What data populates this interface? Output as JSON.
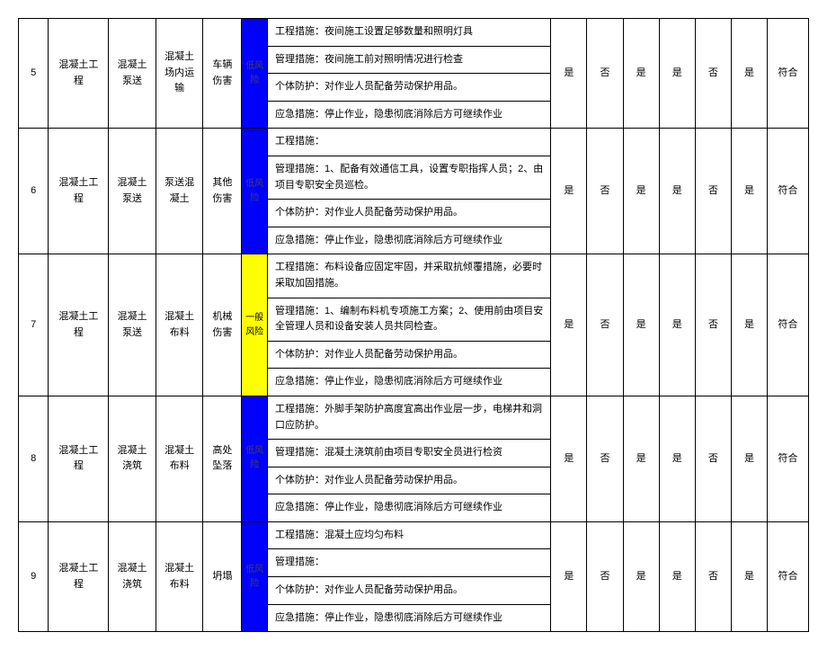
{
  "risk_label_low": "低风险",
  "risk_label_general": "一般风险",
  "rows": [
    {
      "no": "5",
      "project": "混凝土工程",
      "sub": "混凝土泵送",
      "work": "混凝土场内运输",
      "hazard": "车辆伤害",
      "risk": "low",
      "m1": "工程措施：夜间施工设置足够数量和照明灯具",
      "m2": "管理措施：夜间施工前对照明情况进行检查",
      "m3": "个体防护：对作业人员配备劳动保护用品。",
      "m4": "应急措施：停止作业，隐患彻底消除后方可继续作业",
      "c1": "是",
      "c2": "否",
      "c3": "是",
      "c4": "是",
      "c5": "否",
      "c6": "是",
      "result": "符合"
    },
    {
      "no": "6",
      "project": "混凝土工程",
      "sub": "混凝土泵送",
      "work": "泵送混凝土",
      "hazard": "其他伤害",
      "risk": "low",
      "m1": "工程措施：",
      "m2": "管理措施：1、配备有效通信工具，设置专职指挥人员；2、由项目专职安全员巡检。",
      "m3": "个体防护：对作业人员配备劳动保护用品。",
      "m4": "应急措施：停止作业，隐患彻底消除后方可继续作业",
      "c1": "是",
      "c2": "否",
      "c3": "是",
      "c4": "是",
      "c5": "否",
      "c6": "是",
      "result": "符合"
    },
    {
      "no": "7",
      "project": "混凝土工程",
      "sub": "混凝土泵送",
      "work": "混凝土布料",
      "hazard": "机械伤害",
      "risk": "general",
      "m1": "工程措施：布料设备应固定牢固，并采取抗倾覆措施，必要时采取加固措施。",
      "m2": "管理措施：1、编制布料机专项施工方案；2、使用前由项目安全管理人员和设备安装人员共同检查。",
      "m3": "个体防护：对作业人员配备劳动保护用品。",
      "m4": "应急措施：停止作业，隐患彻底消除后方可继续作业",
      "c1": "是",
      "c2": "否",
      "c3": "是",
      "c4": "是",
      "c5": "否",
      "c6": "是",
      "result": "符合"
    },
    {
      "no": "8",
      "project": "混凝土工程",
      "sub": "混凝土浇筑",
      "work": "混凝土布料",
      "hazard": "高处坠落",
      "risk": "low",
      "m1": "工程措施：外脚手架防护高度宜高出作业层一步，电梯井和洞口应防护。",
      "m2": "管理措施：混凝土浇筑前由项目专职安全员进行检资",
      "m3": "个体防护：对作业人员配备劳动保护用品。",
      "m4": "应急措施：停止作业，隐患彻底消除后方可继续作业",
      "c1": "是",
      "c2": "否",
      "c3": "是",
      "c4": "是",
      "c5": "否",
      "c6": "是",
      "result": "符合"
    },
    {
      "no": "9",
      "project": "混凝土工程",
      "sub": "混凝土浇筑",
      "work": "混凝土布料",
      "hazard": "坍塌",
      "risk": "low",
      "m1": "工程措施：混凝土应均匀布料",
      "m2": "管理措施：",
      "m3": "个体防护：对作业人员配备劳动保护用品。",
      "m4": "应急措施：停止作业，隐患彻底消除后方可继续作业",
      "c1": "是",
      "c2": "否",
      "c3": "是",
      "c4": "是",
      "c5": "否",
      "c6": "是",
      "result": "符合"
    }
  ]
}
